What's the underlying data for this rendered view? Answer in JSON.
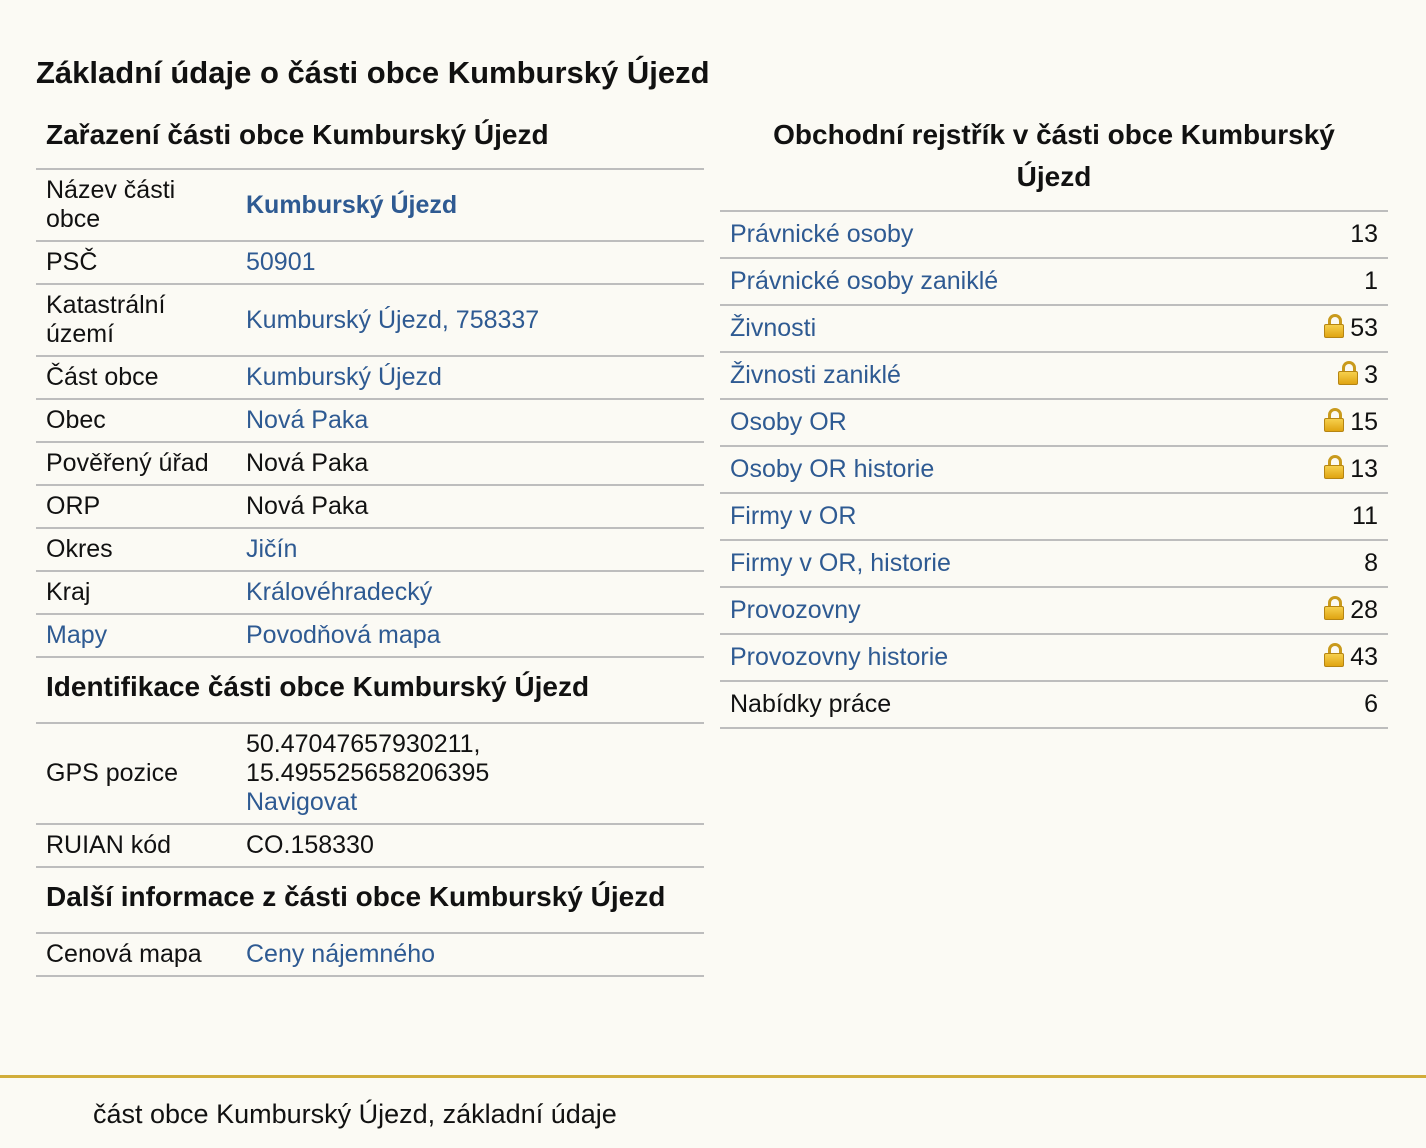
{
  "page_title": "Základní údaje o části obce Kumburský Újezd",
  "left": {
    "zarazeni": {
      "heading": "Zařazení části obce Kumburský Újezd",
      "rows": [
        {
          "label": "Název části obce",
          "value": "Kumburský Újezd"
        },
        {
          "label": "PSČ",
          "value": "50901"
        },
        {
          "label": "Katastrální území",
          "value": "Kumburský Újezd, 758337"
        },
        {
          "label": "Část obce",
          "value": "Kumburský Újezd"
        },
        {
          "label": "Obec",
          "value": "Nová Paka"
        },
        {
          "label": "Pověřený úřad",
          "value": "Nová Paka"
        },
        {
          "label": "ORP",
          "value": "Nová Paka"
        },
        {
          "label": "Okres",
          "value": "Jičín"
        },
        {
          "label": "Kraj",
          "value": "Královéhradecký"
        },
        {
          "label": "Mapy",
          "value": "Povodňová mapa"
        }
      ]
    },
    "identifikace": {
      "heading": "Identifikace části obce Kumburský Újezd",
      "gps_label": "GPS pozice",
      "gps_lat": "50.47047657930211,",
      "gps_lon": "15.495525658206395",
      "gps_nav": "Navigovat",
      "ruian_label": "RUIAN kód",
      "ruian_value": "CO.158330"
    },
    "dalsi": {
      "heading": "Další informace z části obce Kumburský Újezd",
      "label": "Cenová mapa",
      "value": "Ceny nájemného"
    }
  },
  "right": {
    "heading": "Obchodní rejstřík v části obce Kumburský Újezd",
    "rows": [
      {
        "label": "Právnické osoby",
        "count": "13"
      },
      {
        "label": "Právnické osoby zaniklé",
        "count": "1"
      },
      {
        "label": "Živnosti",
        "count": "53",
        "icon": "lock-icon"
      },
      {
        "label": "Živnosti zaniklé",
        "count": "3",
        "icon": "lock-icon"
      },
      {
        "label": "Osoby OR",
        "count": "15",
        "icon": "lock-icon"
      },
      {
        "label": "Osoby OR historie",
        "count": "13",
        "icon": "lock-icon"
      },
      {
        "label": "Firmy v OR",
        "count": "11"
      },
      {
        "label": "Firmy v OR, historie",
        "count": "8"
      },
      {
        "label": "Provozovny",
        "count": "28",
        "icon": "lock-icon"
      },
      {
        "label": "Provozovny historie",
        "count": "43",
        "icon": "lock-icon"
      },
      {
        "label": "Nabídky práce",
        "count": "6"
      }
    ]
  },
  "footer": {
    "text": "část obce Kumburský Újezd, základní údaje"
  },
  "colors": {
    "background": "#fbfaf4",
    "link": "#2e5a92",
    "footer_rule": "#d1ad3a",
    "lock": "#e0a412"
  }
}
